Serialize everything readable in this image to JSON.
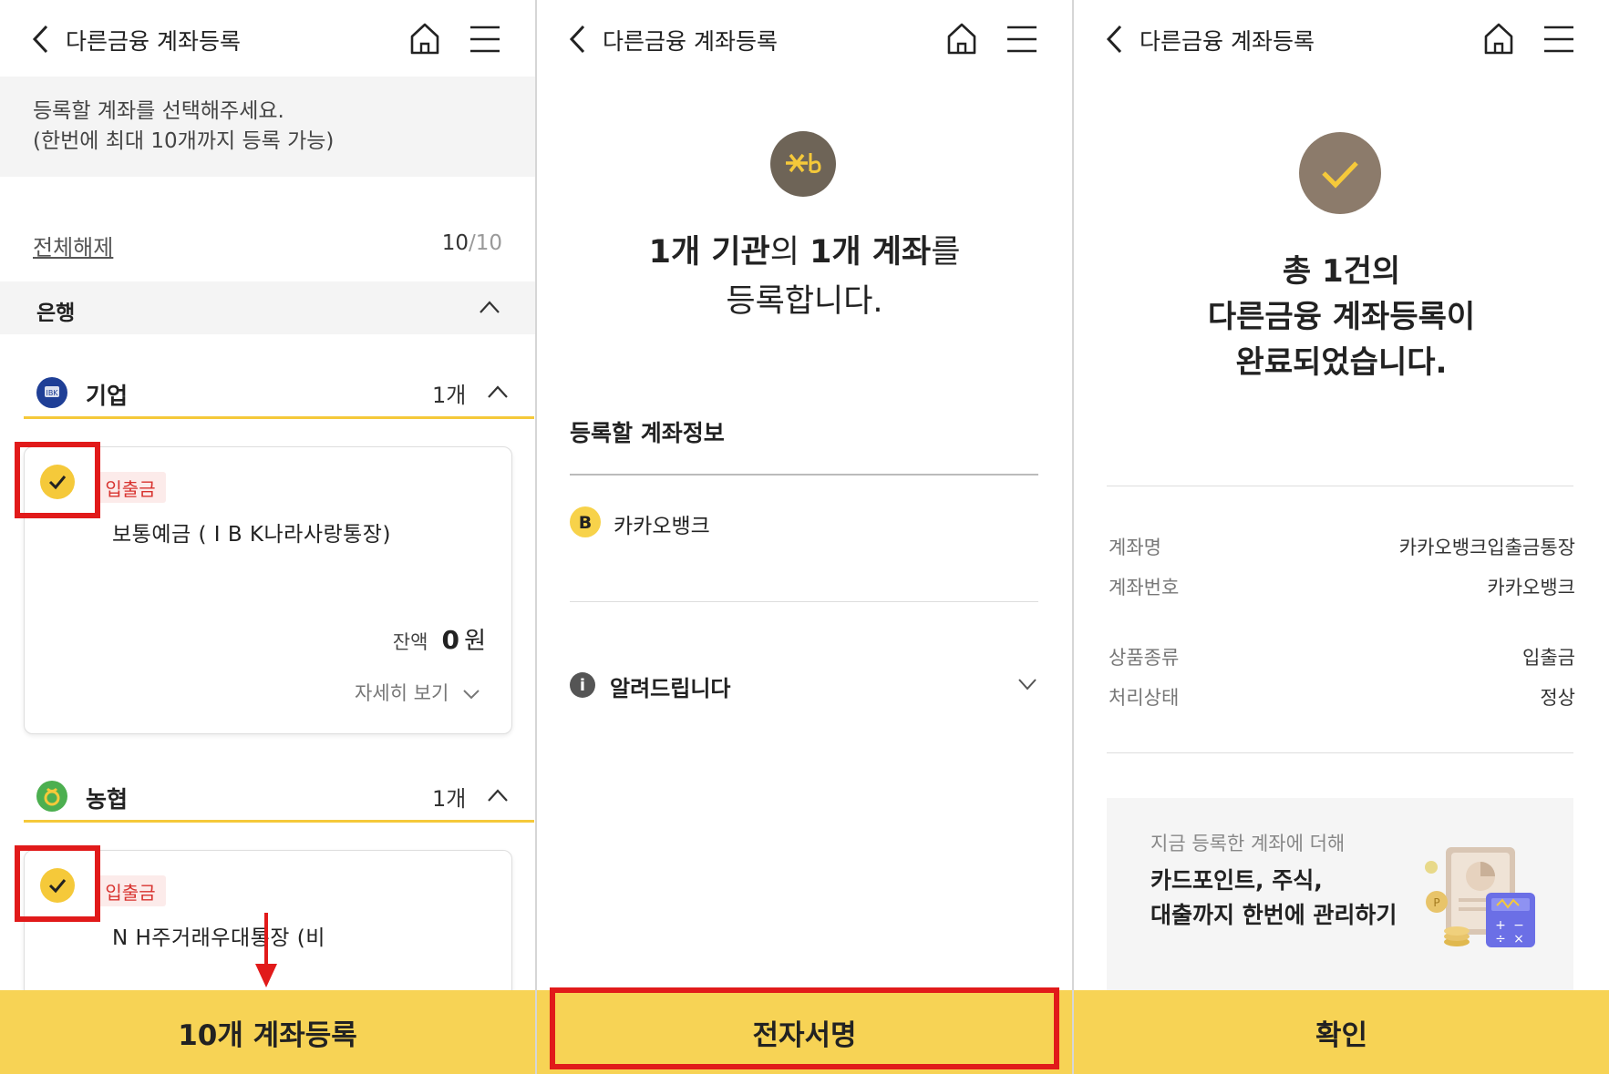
{
  "panel1": {
    "header_title": "다른금융 계좌등록",
    "guide_line1": "등록할 계좌를 선택해주세요.",
    "guide_line2": "(한번에 최대 10개까지 등록 가능)",
    "clear_all": "전체해제",
    "count_selected": "10",
    "count_max": "/10",
    "category": "은행",
    "banks": [
      {
        "name": "기업",
        "count": "1개",
        "badge": "입출금",
        "account": "보통예금 ( I B K나라사랑통장)",
        "balance_label": "잔액",
        "balance_value": "0",
        "balance_unit": "원",
        "detail_link": "자세히 보기"
      },
      {
        "name": "농협",
        "count": "1개",
        "badge": "입출금",
        "account": "N H주거래우대통장 (비"
      }
    ],
    "bottom_button": "10개 계좌등록"
  },
  "panel2": {
    "header_title": "다른금융 계좌등록",
    "msg_line1_a": "1개 기관",
    "msg_line1_b": "의 ",
    "msg_line1_c": "1개 계좌",
    "msg_line1_d": "를",
    "msg_line2": "등록합니다.",
    "section_title": "등록할 계좌정보",
    "bank_name": "카카오뱅크",
    "notice": "알려드립니다",
    "bottom_button": "전자서명"
  },
  "panel3": {
    "header_title": "다른금융 계좌등록",
    "msg_line1": "총 1건의",
    "msg_line2": "다른금융 계좌등록이",
    "msg_line3": "완료되었습니다.",
    "details": [
      {
        "key": "계좌명",
        "value": "카카오뱅크입출금통장"
      },
      {
        "key": "계좌번호",
        "value": "카카오뱅크"
      },
      {
        "key": "상품종류",
        "value": "입출금"
      },
      {
        "key": "처리상태",
        "value": "정상"
      }
    ],
    "promo_sub": "지금 등록한 계좌에 더해",
    "promo_line1": "카드포인트, 주식,",
    "promo_line2": "대출까지 한번에 관리하기",
    "bottom_button": "확인"
  },
  "colors": {
    "accent_yellow": "#f7d355",
    "highlight_red": "#e11a1a",
    "check_yellow": "#f5c93a",
    "kb_brown": "#6e6457",
    "done_brown": "#8c7b6b"
  },
  "icons": [
    "back-icon",
    "home-icon",
    "menu-icon",
    "chevron-up-icon",
    "chevron-down-icon",
    "check-icon",
    "info-icon",
    "kb-logo",
    "ibk-logo",
    "nh-logo",
    "kakaobank-logo",
    "arrow-down-icon"
  ]
}
